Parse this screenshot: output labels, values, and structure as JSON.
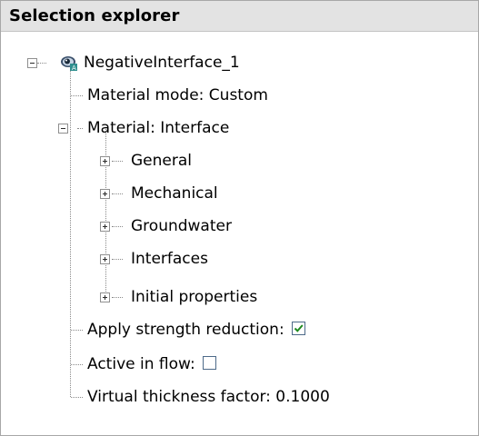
{
  "panel": {
    "title": "Selection explorer"
  },
  "tree": {
    "root": {
      "label": "NegativeInterface_1",
      "icon": "interface-eye-icon",
      "material_mode": "Material mode: Custom",
      "material": {
        "label": "Material: Interface",
        "children": [
          "General",
          "Mechanical",
          "Groundwater",
          "Interfaces",
          "Initial properties"
        ]
      },
      "apply_strength_reduction": {
        "label": "Apply strength reduction:",
        "checked": true
      },
      "active_in_flow": {
        "label": "Active in flow:",
        "checked": false
      },
      "virtual_thickness": "Virtual thickness factor: 0.1000"
    }
  },
  "colors": {
    "header_bg": "#e3e3e3",
    "check_green": "#1e8a1e",
    "checkbox_border": "#4d6a89"
  }
}
